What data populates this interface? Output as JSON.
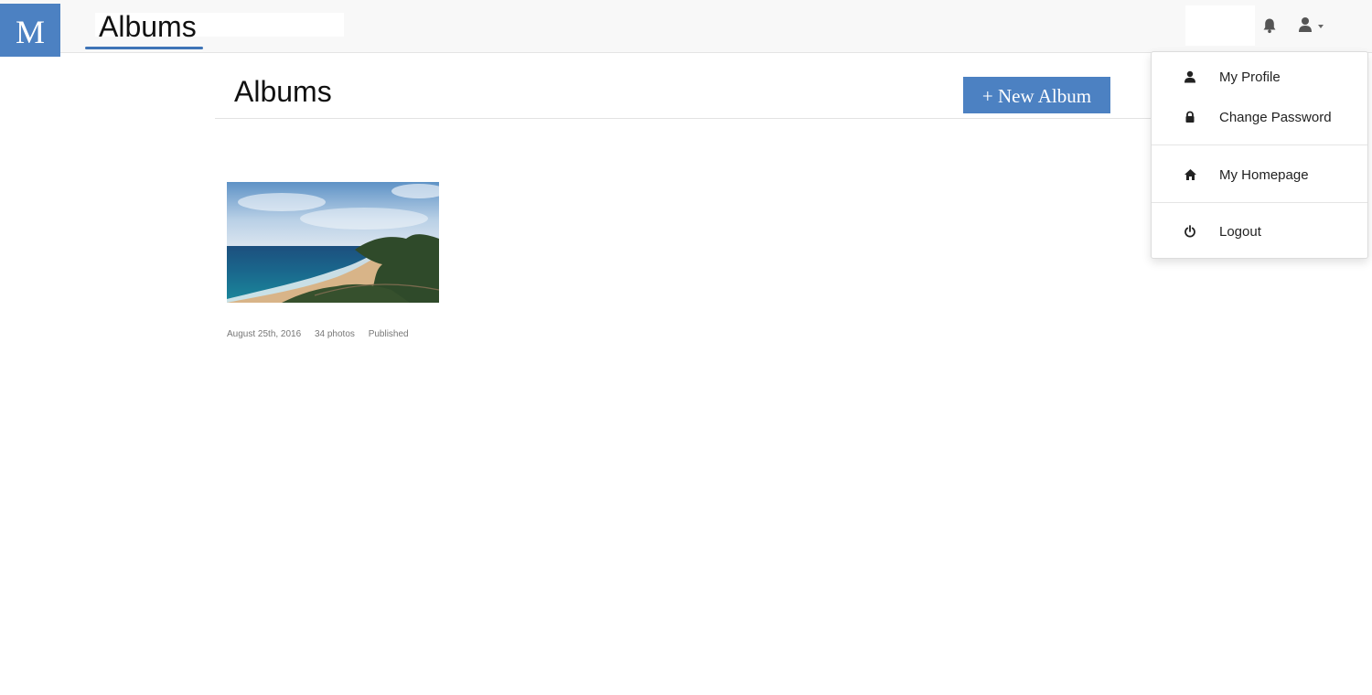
{
  "brand": {
    "logo_letter": "M",
    "color": "#4c81c2"
  },
  "navbar": {
    "title": "Albums",
    "icons": {
      "notifications": "bell-icon",
      "user": "user-icon"
    }
  },
  "page": {
    "title": "Albums",
    "new_album_label": "+ New Album"
  },
  "albums": [
    {
      "image": "coastal-landscape-photo",
      "date": "August 25th, 2016",
      "photos": "34 photos",
      "status": "Published"
    }
  ],
  "user_menu": {
    "items": [
      {
        "label": "My Profile",
        "icon": "user-icon"
      },
      {
        "label": "Change Password",
        "icon": "lock-icon"
      },
      {
        "label": "My Homepage",
        "icon": "home-icon"
      },
      {
        "label": "Logout",
        "icon": "power-icon"
      }
    ]
  }
}
